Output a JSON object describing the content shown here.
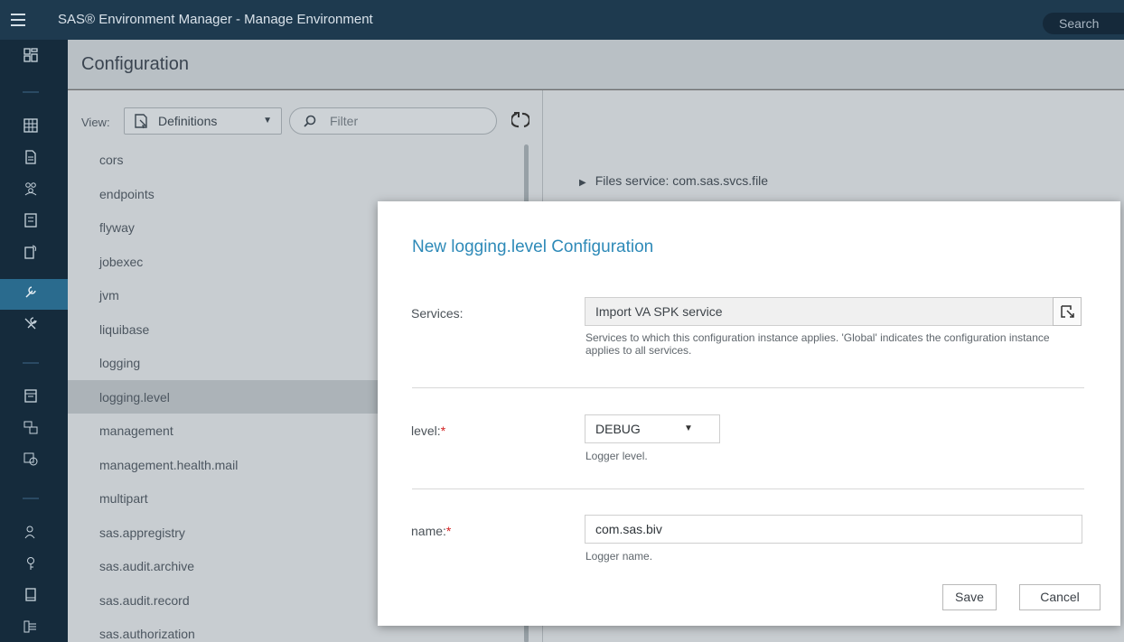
{
  "topbar": {
    "app_title": "SAS® Environment Manager - Manage Environment",
    "search_placeholder": "Search"
  },
  "page": {
    "title": "Configuration"
  },
  "view": {
    "label": "View:",
    "selected": "Definitions",
    "filter_placeholder": "Filter"
  },
  "definitions": [
    "cors",
    "endpoints",
    "flyway",
    "jobexec",
    "jvm",
    "liquibase",
    "logging",
    "logging.level",
    "management",
    "management.health.mail",
    "multipart",
    "sas.appregistry",
    "sas.audit.archive",
    "sas.audit.record",
    "sas.authorization"
  ],
  "selected_definition": "logging.level",
  "right_pane": {
    "row1": "Files service: com.sas.svcs.file"
  },
  "modal": {
    "title": "New logging.level Configuration",
    "services": {
      "label": "Services:",
      "value": "Import VA SPK service",
      "help": "Services to which this configuration instance applies. 'Global' indicates the configuration instance applies to all services."
    },
    "level": {
      "label": "level:",
      "required": "*",
      "value": "DEBUG",
      "help": "Logger level."
    },
    "name": {
      "label": "name:",
      "required": "*",
      "value": "com.sas.biv",
      "help": "Logger name."
    },
    "save_label": "Save",
    "cancel_label": "Cancel"
  },
  "colors": {
    "topbar": "#1e3a4f",
    "rail": "#152b3c",
    "active_rail": "#2a6b8e",
    "modal_title": "#2e8ab8",
    "required": "#d21f1f"
  }
}
